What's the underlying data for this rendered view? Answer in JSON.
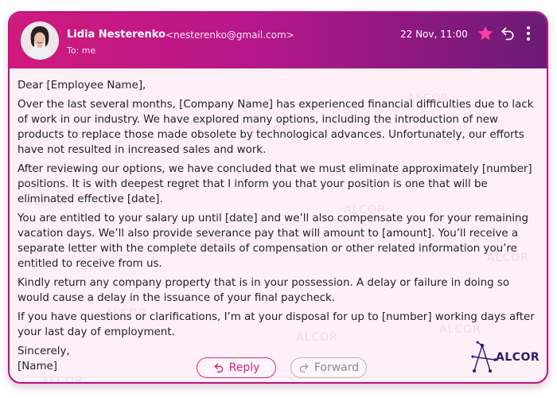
{
  "email": {
    "sender_name": "Lidia Nesterenko",
    "sender_email": "<nesterenko@gmail.com>",
    "recipient": "To: me",
    "timestamp": "22 Nov, 11:00"
  },
  "icons": {
    "star": "star-icon",
    "reply": "reply-arrow-icon",
    "more": "more-vertical-icon",
    "forward": "forward-arrow-icon"
  },
  "colors": {
    "accent": "#d02585",
    "header_start": "#d01a7d",
    "header_end": "#6b1a76",
    "star": "#ff3ea5",
    "body_bg": "#fff0f8"
  },
  "body": {
    "greeting": "Dear [Employee Name],",
    "paragraphs": [
      "Over the last several months, [Company Name] has experienced financial difficulties due to lack of work in our industry. We have explored many options, including the introduction of new products to replace those made obsolete by technological advances. Unfortunately, our efforts have not resulted in increased sales and work.",
      "After reviewing our options, we have concluded that we must eliminate approximately [number] positions. It is with deepest regret that I inform you that your position is one that will be eliminated effective [date].",
      "You are entitled to your salary up until [date] and we’ll also compensate you for your remaining vacation days. We’ll also provide severance pay that will amount to [amount]. You’ll receive a separate letter with the complete details of compensation or other related information you’re entitled to receive from us.",
      "Kindly return any company property that is in your possession. A delay or failure in doing so would cause a delay in the issuance of your final paycheck.",
      "If you have questions or clarifications, I’m at your disposal for up to [number] working days after your last day of employment."
    ],
    "closing": "Sincerely,",
    "signature": "[Name]"
  },
  "actions": {
    "reply_label": "Reply",
    "forward_label": "Forward"
  },
  "brand": {
    "logo_text": "ALCOR",
    "watermark_text": "ALCOR"
  }
}
